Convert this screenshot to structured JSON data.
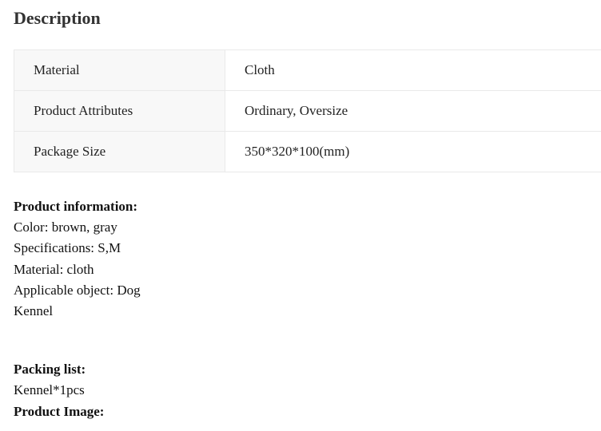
{
  "title": "Description",
  "attributes": [
    {
      "key": "Material",
      "value": "Cloth"
    },
    {
      "key": "Product Attributes",
      "value": "Ordinary, Oversize"
    },
    {
      "key": "Package Size",
      "value": "350*320*100(mm)"
    }
  ],
  "product_info": {
    "heading": "Product information:",
    "lines": [
      "Color: brown, gray",
      "Specifications: S,M",
      "Material: cloth",
      "Applicable object: Dog",
      "Kennel"
    ]
  },
  "packing": {
    "heading": "Packing list:",
    "line": "Kennel*1pcs"
  },
  "image_heading": "Product Image:"
}
